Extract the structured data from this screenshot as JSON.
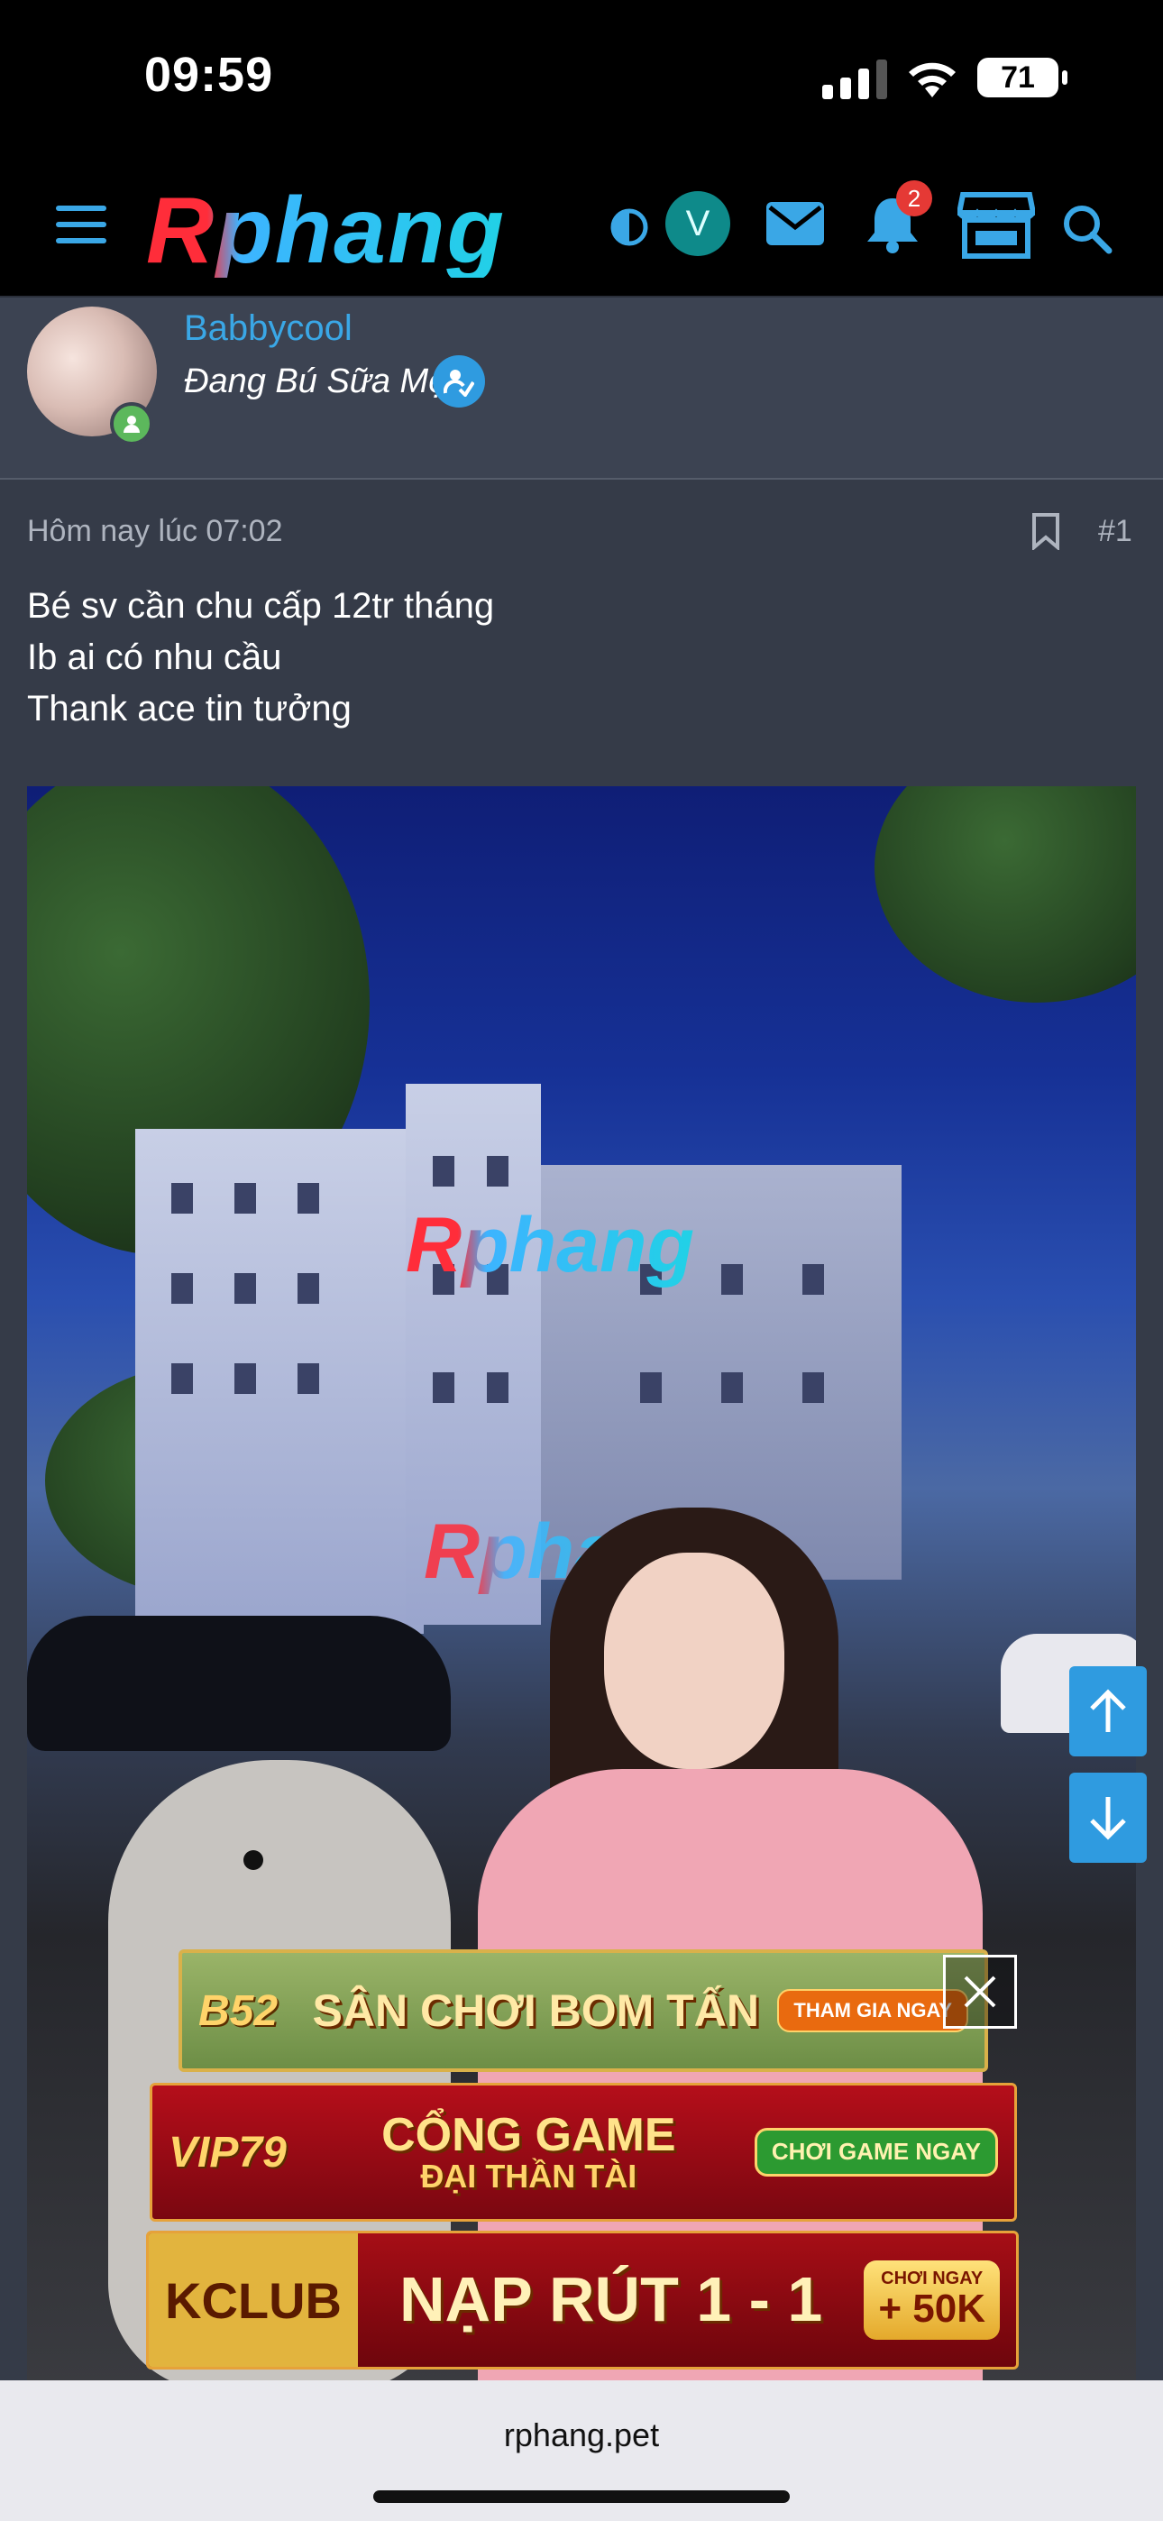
{
  "status_bar": {
    "time": "09:59",
    "battery": "71"
  },
  "nav": {
    "logo": "Rphang",
    "user_initial": "V",
    "notification_count": "2",
    "icons": [
      "menu-icon",
      "theme-toggle-icon",
      "mail-icon",
      "bell-icon",
      "store-icon",
      "search-icon"
    ]
  },
  "author": {
    "name": "Babbycool",
    "title": "Đang Bú Sữa Mẹ"
  },
  "post": {
    "timestamp": "Hôm nay lúc 07:02",
    "number": "#1",
    "body_lines": [
      "Bé sv cần chu cấp 12tr tháng",
      "Ib ai có nhu cầu",
      "Thank ace tin tưởng"
    ],
    "watermark": "Rphang"
  },
  "ads": [
    {
      "brand": "B52",
      "text": "SÂN CHƠI BOM TẤN",
      "cta": "THAM GIA NGAY"
    },
    {
      "brand": "VIP79",
      "text": "CỔNG GAME",
      "subtext": "ĐẠI THẦN TÀI",
      "cta": "CHƠI GAME NGAY"
    },
    {
      "brand": "KCLUB",
      "text": "NẠP RÚT 1 - 1",
      "cta_small": "CHƠI NGAY",
      "cta": "+ 50K"
    }
  ],
  "browser": {
    "url": "rphang.pet"
  },
  "colors": {
    "accent": "#3aa7e6",
    "nav_bg": "#000000",
    "page_bg": "#353b48",
    "user_row_bg": "#3c4352",
    "badge": "#e53935",
    "online": "#5cb85c"
  }
}
